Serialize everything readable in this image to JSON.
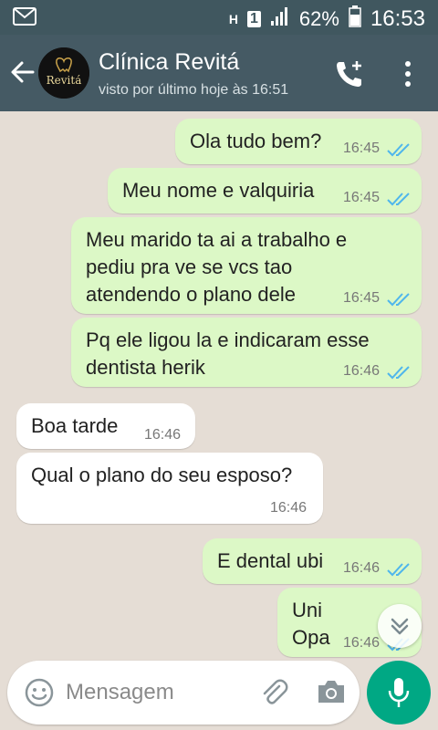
{
  "status_bar": {
    "network_h": "H",
    "sim": "1",
    "battery": "62%",
    "time": "16:53"
  },
  "header": {
    "contact_name": "Clínica Revitá",
    "last_seen": "visto por último hoje às 16:51",
    "avatar_text": "Revitá"
  },
  "messages": [
    {
      "dir": "out",
      "text": "Ola tudo bem?",
      "time": "16:45",
      "status": "read"
    },
    {
      "dir": "out",
      "text": "Meu nome e valquiria",
      "time": "16:45",
      "status": "read"
    },
    {
      "dir": "out",
      "text": "Meu marido ta ai a trabalho e\npediu pra ve se vcs tao\natendendo o plano dele",
      "time": "16:45",
      "status": "read"
    },
    {
      "dir": "out",
      "text": "Pq ele ligou la e indicaram esse\ndentista herik",
      "time": "16:46",
      "status": "read"
    },
    {
      "dir": "in",
      "text": "Boa tarde",
      "time": "16:46"
    },
    {
      "dir": "in",
      "text": "Qual o plano do seu esposo?",
      "time": "16:46"
    },
    {
      "dir": "out",
      "text": "E dental ubi",
      "time": "16:46",
      "status": "read"
    },
    {
      "dir": "out",
      "text": "Uni\nOpa",
      "time": "16:46",
      "status": "read"
    }
  ],
  "input": {
    "placeholder": "Mensagem"
  },
  "colors": {
    "header": "#455a64",
    "status_bar": "#40575f",
    "outgoing_bubble": "#dcf8c6",
    "incoming_bubble": "#ffffff",
    "read_ticks": "#4fb6ec",
    "mic_button": "#00a884",
    "chat_background": "#e5ddd5"
  },
  "icons": [
    "envelope-icon",
    "signal-icon",
    "battery-icon",
    "back-arrow-icon",
    "add-call-icon",
    "menu-dots-icon",
    "double-check-icon",
    "chevron-down-icon",
    "emoji-icon",
    "attach-icon",
    "camera-icon",
    "mic-icon"
  ]
}
